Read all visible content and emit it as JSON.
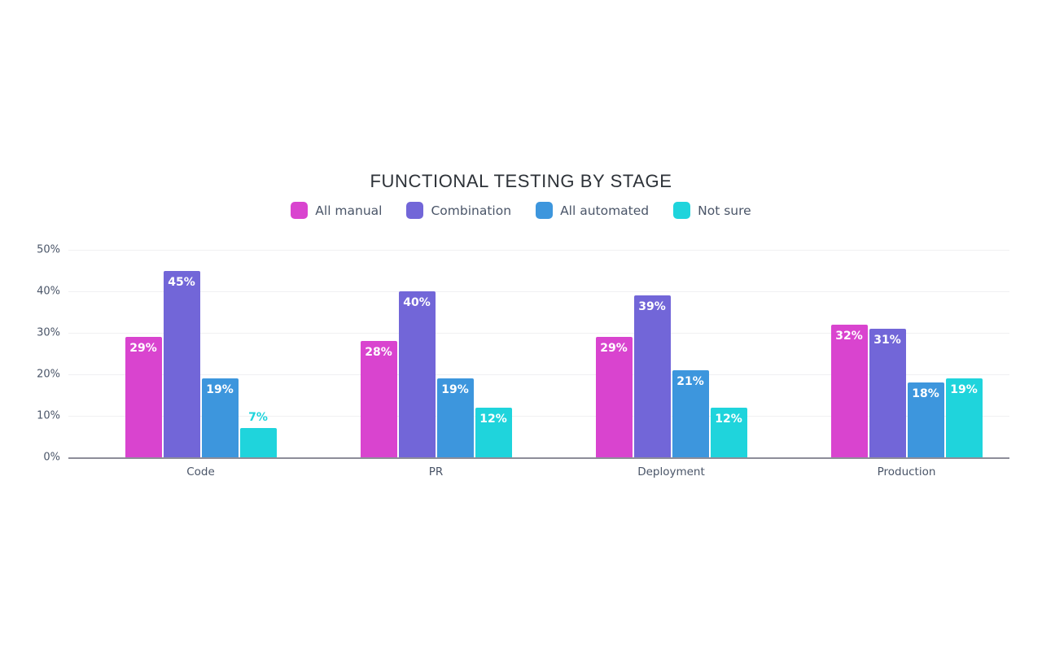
{
  "chart_data": {
    "type": "bar",
    "title": "FUNCTIONAL TESTING BY STAGE",
    "subtitle": "",
    "xlabel": "",
    "ylabel": "",
    "categories": [
      "Code",
      "PR",
      "Deployment",
      "Production"
    ],
    "series": [
      {
        "name": "All manual",
        "color": "#d944cf",
        "values": [
          29,
          28,
          29,
          32
        ]
      },
      {
        "name": "Combination",
        "color": "#7266d8",
        "values": [
          45,
          40,
          39,
          31
        ]
      },
      {
        "name": "All automated",
        "color": "#3d96dd",
        "values": [
          19,
          19,
          21,
          18
        ]
      },
      {
        "name": "Not sure",
        "color": "#1fd4dc",
        "values": [
          7,
          12,
          12,
          19
        ]
      }
    ],
    "value_labels": [
      [
        "29%",
        "45%",
        "19%",
        "7%"
      ],
      [
        "28%",
        "40%",
        "19%",
        "12%"
      ],
      [
        "29%",
        "39%",
        "21%",
        "12%"
      ],
      [
        "32%",
        "31%",
        "18%",
        "19%"
      ]
    ],
    "ylim": [
      0,
      50
    ],
    "ytick_values": [
      0,
      10,
      20,
      30,
      40,
      50
    ],
    "ytick_labels": [
      "0%",
      "10%",
      "20%",
      "30%",
      "40%",
      "50%"
    ],
    "grid": true,
    "legend_position": "top-center",
    "value_label_suffix": "%",
    "colors": {
      "background": "#ffffff",
      "gridline": "#f0f0f2",
      "axis_line": "#8d8d99",
      "tick_text": "#4a5568",
      "title_text": "#2d3238",
      "inside_label_text": "#ffffff"
    }
  }
}
